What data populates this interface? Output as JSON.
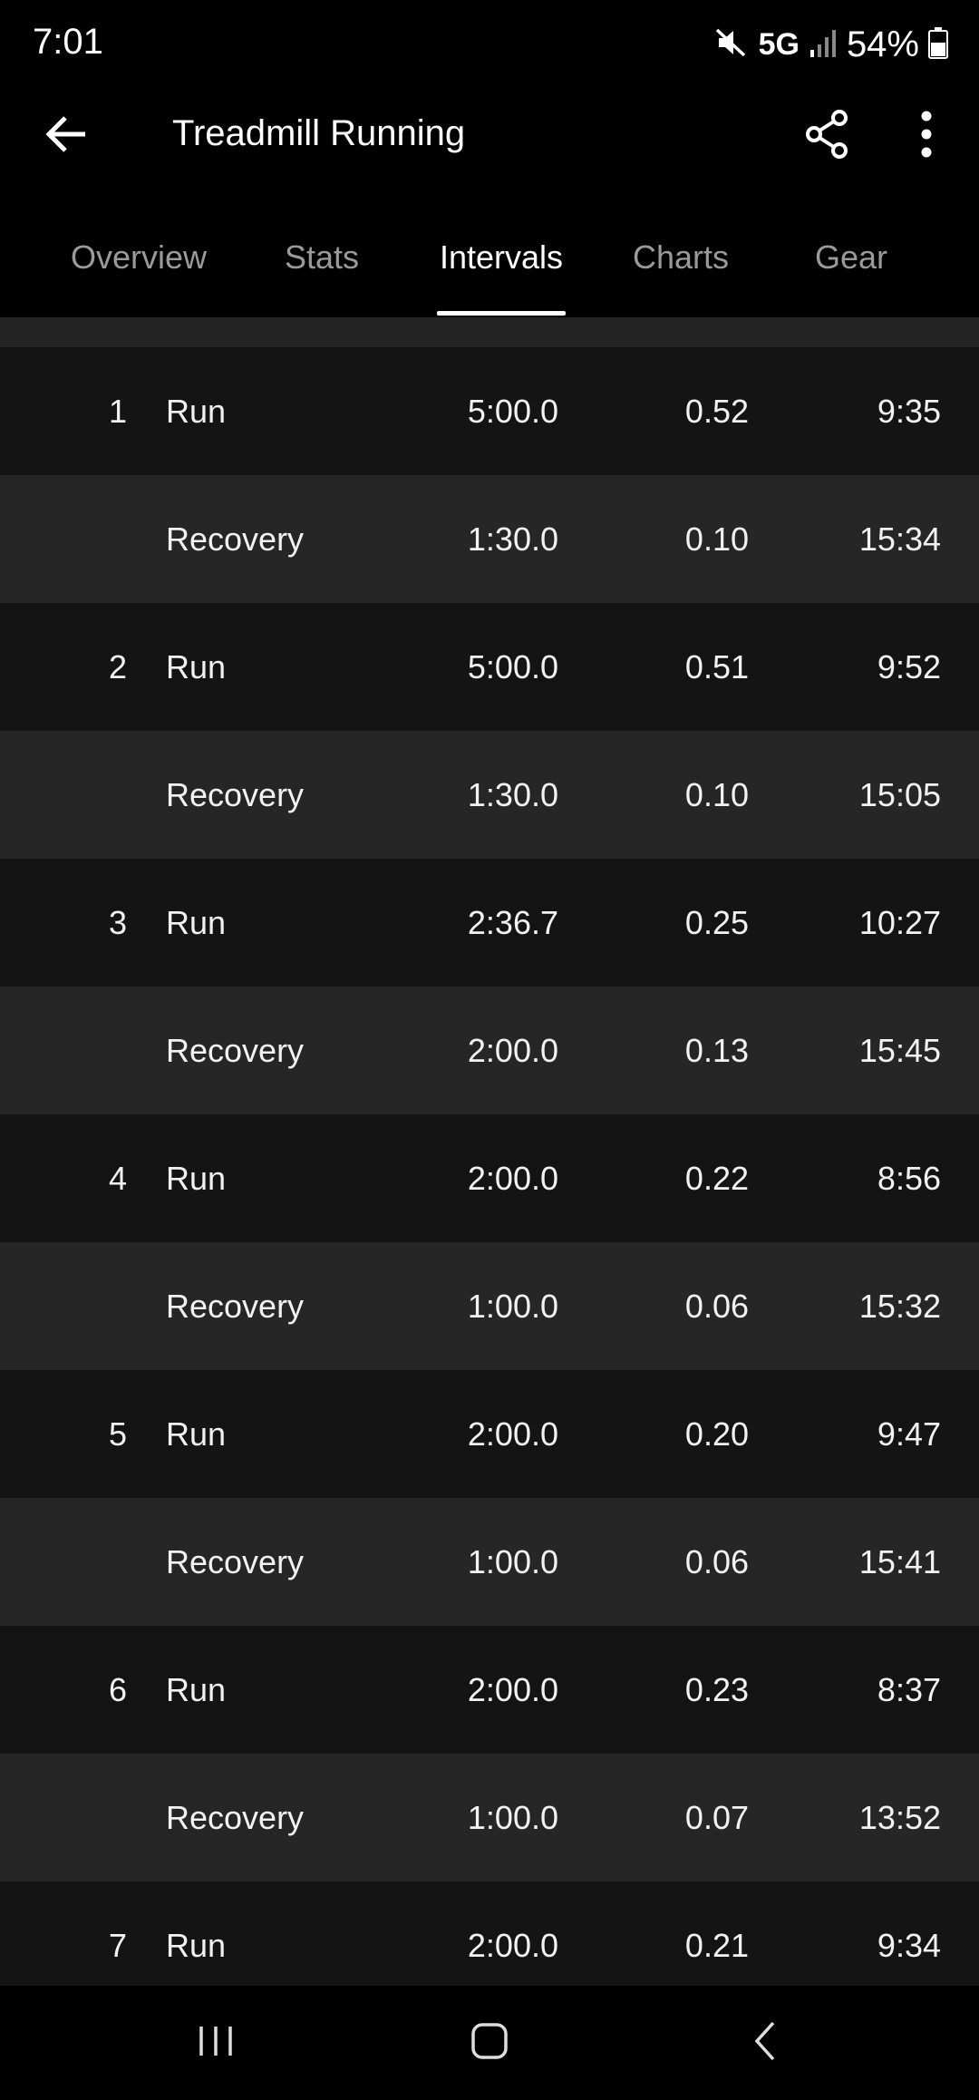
{
  "status_bar": {
    "time": "7:01",
    "network": "5G",
    "battery": "54%"
  },
  "app_bar": {
    "title": "Treadmill Running"
  },
  "tabs": [
    {
      "label": "Overview",
      "active": false
    },
    {
      "label": "Stats",
      "active": false
    },
    {
      "label": "Intervals",
      "active": true
    },
    {
      "label": "Charts",
      "active": false
    },
    {
      "label": "Gear",
      "active": false
    }
  ],
  "intervals": [
    {
      "num": "1",
      "type": "Run",
      "time": "5:00.0",
      "distance": "0.52",
      "pace": "9:35"
    },
    {
      "num": "",
      "type": "Recovery",
      "time": "1:30.0",
      "distance": "0.10",
      "pace": "15:34"
    },
    {
      "num": "2",
      "type": "Run",
      "time": "5:00.0",
      "distance": "0.51",
      "pace": "9:52"
    },
    {
      "num": "",
      "type": "Recovery",
      "time": "1:30.0",
      "distance": "0.10",
      "pace": "15:05"
    },
    {
      "num": "3",
      "type": "Run",
      "time": "2:36.7",
      "distance": "0.25",
      "pace": "10:27"
    },
    {
      "num": "",
      "type": "Recovery",
      "time": "2:00.0",
      "distance": "0.13",
      "pace": "15:45"
    },
    {
      "num": "4",
      "type": "Run",
      "time": "2:00.0",
      "distance": "0.22",
      "pace": "8:56"
    },
    {
      "num": "",
      "type": "Recovery",
      "time": "1:00.0",
      "distance": "0.06",
      "pace": "15:32"
    },
    {
      "num": "5",
      "type": "Run",
      "time": "2:00.0",
      "distance": "0.20",
      "pace": "9:47"
    },
    {
      "num": "",
      "type": "Recovery",
      "time": "1:00.0",
      "distance": "0.06",
      "pace": "15:41"
    },
    {
      "num": "6",
      "type": "Run",
      "time": "2:00.0",
      "distance": "0.23",
      "pace": "8:37"
    },
    {
      "num": "",
      "type": "Recovery",
      "time": "1:00.0",
      "distance": "0.07",
      "pace": "13:52"
    },
    {
      "num": "7",
      "type": "Run",
      "time": "2:00.0",
      "distance": "0.21",
      "pace": "9:34"
    }
  ],
  "colors": {
    "background": "#000000",
    "run_row": "#141414",
    "recovery_row": "#262626",
    "tab_inactive": "#9a9a9a",
    "tab_active": "#ffffff"
  },
  "icons": {
    "back": "arrow-left-icon",
    "share": "share-icon",
    "more": "more-vertical-icon",
    "mute": "mute-icon",
    "signal": "signal-icon",
    "battery": "battery-icon",
    "nav_recents": "recents-icon",
    "nav_home": "home-icon",
    "nav_back": "chevron-left-icon"
  }
}
